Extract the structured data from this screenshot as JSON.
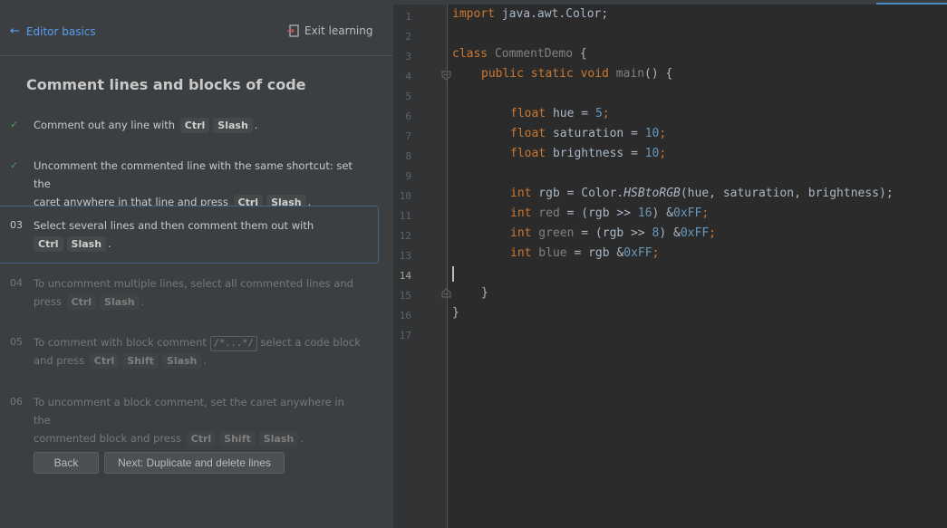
{
  "panel": {
    "back_label": "Editor basics",
    "exit_label": "Exit learning",
    "lesson_title": "Comment lines and blocks of code",
    "steps": [
      {
        "marker": "✓",
        "status": "done",
        "text_a": "Comment out any line with",
        "keys": [
          "Ctrl",
          "Slash"
        ],
        "text_b": "."
      },
      {
        "marker": "✓",
        "status": "done",
        "line1": "Uncomment the commented line with the same shortcut: set the",
        "line2_a": "caret anywhere in that line and press",
        "keys": [
          "Ctrl",
          "Slash"
        ],
        "line2_b": "."
      },
      {
        "marker": "03",
        "status": "current",
        "line1": "Select several lines and then comment them out with",
        "keys": [
          "Ctrl",
          "Slash"
        ],
        "line2_b": "."
      },
      {
        "marker": "04",
        "status": "pending",
        "line1": "To uncomment multiple lines, select all commented lines and",
        "line2_a": "press",
        "keys": [
          "Ctrl",
          "Slash"
        ],
        "line2_b": "."
      },
      {
        "marker": "05",
        "status": "pending",
        "line1_a": "To comment with block comment",
        "code": "/*...*/",
        "line1_b": "select a code block",
        "line2_a": "and press",
        "keys": [
          "Ctrl",
          "Shift",
          "Slash"
        ],
        "line2_b": "."
      },
      {
        "marker": "06",
        "status": "pending",
        "line1": "To uncomment a block comment, set the caret anywhere in the",
        "line2_a": "commented block and press",
        "keys": [
          "Ctrl",
          "Shift",
          "Slash"
        ],
        "line2_b": "."
      }
    ],
    "back_button": "Back",
    "next_button": "Next: Duplicate and delete lines"
  },
  "editor": {
    "line_numbers": [
      "1",
      "2",
      "3",
      "4",
      "5",
      "6",
      "7",
      "8",
      "9",
      "10",
      "11",
      "12",
      "13",
      "14",
      "15",
      "16",
      "17"
    ],
    "active_line": "14",
    "code": {
      "l1_kw": "import",
      "l1_rest": " java.awt.Color;",
      "l3_kw": "class",
      "l3_name": " CommentDemo",
      "l3_rest": " {",
      "l4_kw": "public static void",
      "l4_fn": " main",
      "l4_rest": "() {",
      "l6_kw": "float",
      "l6_var": " hue = ",
      "l6_num": "5",
      "l6_end": ";",
      "l7_kw": "float",
      "l7_var": " saturation = ",
      "l7_num": "10",
      "l7_end": ";",
      "l8_kw": "float",
      "l8_var": " brightness = ",
      "l8_num": "10",
      "l8_end": ";",
      "l10_kw": "int",
      "l10_a": " rgb = Color.",
      "l10_fn": "HSBtoRGB",
      "l10_b": "(hue, saturation, brightness);",
      "l11_kw": "int",
      "l11_var": " red",
      "l11_a": " = (rgb >> ",
      "l11_n1": "16",
      "l11_b": ") &",
      "l11_n2": "0xFF",
      "l11_end": ";",
      "l12_kw": "int",
      "l12_var": " green",
      "l12_a": " = (rgb >> ",
      "l12_n1": "8",
      "l12_b": ") &",
      "l12_n2": "0xFF",
      "l12_end": ";",
      "l13_kw": "int",
      "l13_var": " blue",
      "l13_a": " = rgb &",
      "l13_n2": "0xFF",
      "l13_end": ";",
      "l15": "}",
      "l16": "}"
    }
  },
  "colors": {
    "accent": "#589df6",
    "check": "#499c54",
    "keyword": "#cc7832",
    "number": "#6897bb",
    "function": "#ffc66d"
  },
  "icons": {
    "back": "arrow-left-icon",
    "exit": "exit-icon",
    "done": "checkmark-icon",
    "fold": "fold-icon"
  }
}
